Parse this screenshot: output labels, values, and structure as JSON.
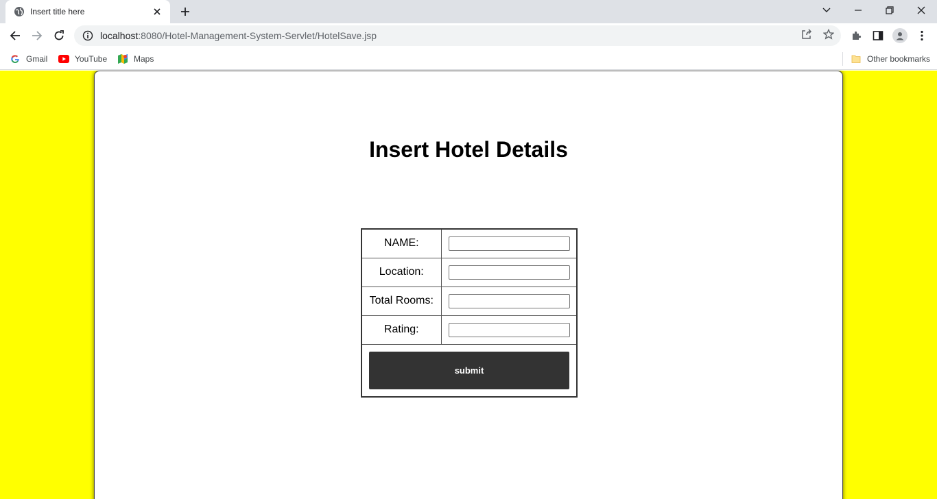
{
  "browser": {
    "tab": {
      "title": "Insert title here"
    },
    "address": {
      "url_host": "localhost",
      "url_rest": ":8080/Hotel-Management-System-Servlet/HotelSave.jsp"
    },
    "bookmarks": [
      {
        "label": "Gmail",
        "icon": "google-icon"
      },
      {
        "label": "YouTube",
        "icon": "youtube-icon"
      },
      {
        "label": "Maps",
        "icon": "maps-icon"
      }
    ],
    "other_bookmarks": "Other bookmarks"
  },
  "page": {
    "background_color": "#ffff00",
    "title": "Insert Hotel Details",
    "form": {
      "fields": [
        {
          "label": "NAME:",
          "value": ""
        },
        {
          "label": "Location:",
          "value": ""
        },
        {
          "label": "Total Rooms:",
          "value": ""
        },
        {
          "label": "Rating:",
          "value": ""
        }
      ],
      "submit_label": "submit"
    }
  }
}
